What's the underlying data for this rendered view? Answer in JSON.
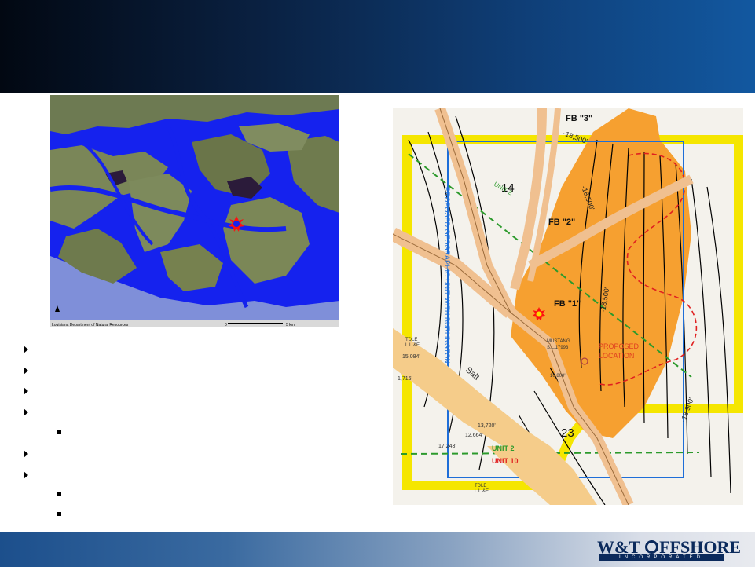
{
  "slide": {
    "colors": {
      "header_dark": "#020812",
      "header_light": "#1258a0",
      "footer_start": "#1c4f8c",
      "map_water": "#1020f0",
      "fault_orange": "#f0a040",
      "reservoir_orange": "#f6a030"
    }
  },
  "logo": {
    "part1": "W&T",
    "part2": "FFSHORE",
    "tagline": "INCORPORATED"
  },
  "satellite_map": {
    "source": "Louisiana Department of Natural Resources",
    "scale_start": "0",
    "scale_end": "5 km",
    "marker_icon": "red-star-marker-icon"
  },
  "geo_map": {
    "fb3": "FB \"3\"",
    "fb2": "FB \"2\"",
    "fb1": "FB \"1\"",
    "block14": "14",
    "block23": "23",
    "unit2_diag": "UNIT 2",
    "unit2": "UNIT 2",
    "unit10": "UNIT 10",
    "proposed_unit": "PROPOSED GEOGRAPHIC UNIT WITH BURLINGTON",
    "proposed_location": "PROPOSED",
    "proposed_location2": "LOCATION",
    "mustang": "MUSTANG",
    "mustang_id": "S.L.17993",
    "contour_a": "-18,500'",
    "contour_b": "-18,500'",
    "contour_c": "-18,500'",
    "contour_d": "-18,900'",
    "salt": "Salt",
    "depth_1": "13,720'",
    "depth_2": "12,664'",
    "depth_3": "15,084'",
    "depth_4": "1,716'",
    "depth_5": "17,243'",
    "depth_6": "16,800'",
    "well_1": "TDLE",
    "well_2": "TDLE",
    "lease_1": "L.L.&E.",
    "lease_2": "L.L.&E.",
    "marker_icon": "orange-star-marker-icon"
  }
}
